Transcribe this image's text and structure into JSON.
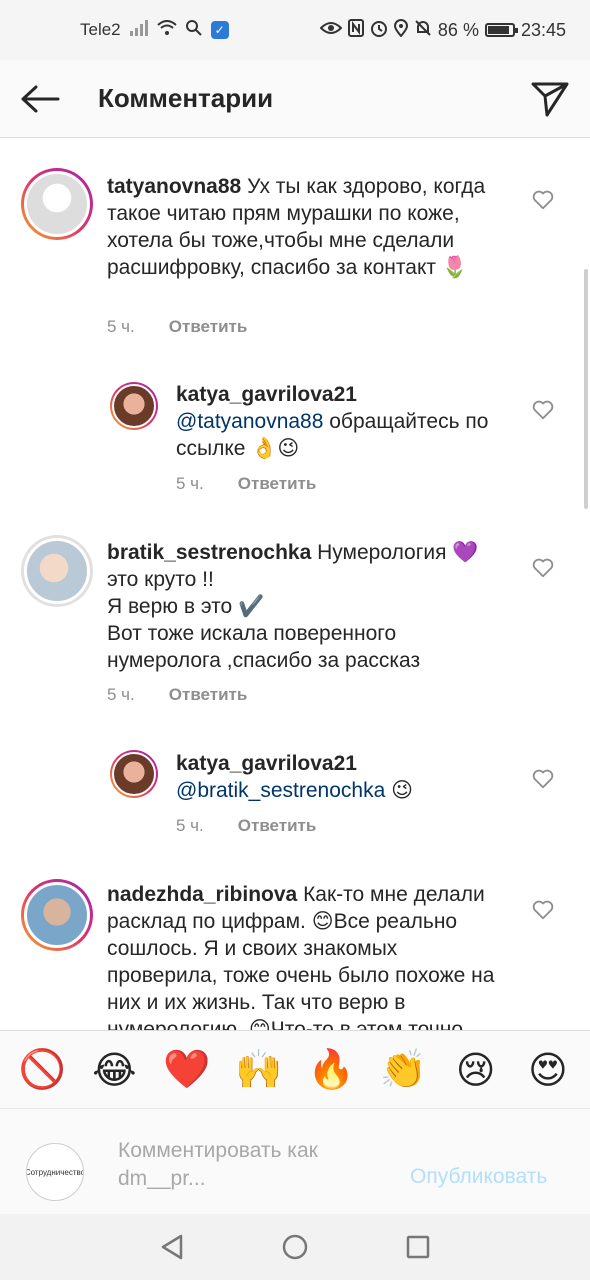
{
  "status_bar": {
    "carrier": "Tele2",
    "battery_percent": "86 %",
    "battery_level": 0.86,
    "time": "23:45"
  },
  "header": {
    "title": "Комментарии"
  },
  "comments": [
    {
      "username": "tatyanovna88",
      "text": "Ух ты как здорово, когда такое читаю прям мурашки по коже, хотела бы тоже,чтобы мне сделали расшифровку, спасибо за контакт 🌷",
      "time": "5 ч.",
      "reply_label": "Ответить"
    },
    {
      "username": "katya_gavrilova21",
      "mention": "@tatyanovna88",
      "text": " обращайтесь по ссылке 👌😉",
      "time": "5 ч.",
      "reply_label": "Ответить"
    },
    {
      "username": "bratik_sestrenochka",
      "text": "Нумерология 💜 это круто !!\nЯ верю в это ✔️\nВот тоже искала поверенного нумеролога ,спасибо за рассказ",
      "time": "5 ч.",
      "reply_label": "Ответить"
    },
    {
      "username": "katya_gavrilova21",
      "mention": "@bratik_sestrenochka",
      "text": " 😉",
      "time": "5 ч.",
      "reply_label": "Ответить"
    },
    {
      "username": "nadezhda_ribinova",
      "text": "Как-то мне делали расклад по цифрам. 😊Все реально сошлось. Я и своих знакомых проверила, тоже очень было похоже на них и их жизнь. Так что верю в нумерологию. 😊Что-то в этом точно",
      "time": "",
      "reply_label": ""
    }
  ],
  "emoji_bar": [
    "🚫",
    "😂",
    "❤️",
    "🙌",
    "🔥",
    "👏",
    "😢",
    "😍"
  ],
  "compose": {
    "avatar_text": "Сотрудничество",
    "placeholder": "Комментировать как dm__pr...",
    "publish_label": "Опубликовать"
  }
}
